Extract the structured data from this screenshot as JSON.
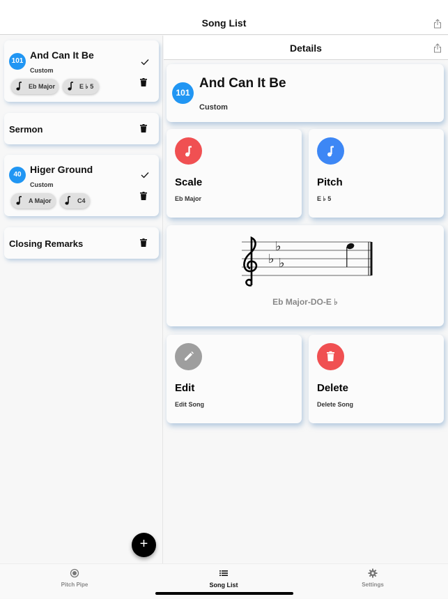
{
  "app": {
    "title": "Song List",
    "share_icon": "share-icon"
  },
  "song_list": {
    "items": [
      {
        "type": "song",
        "number": "101",
        "title": "And Can It Be",
        "subtitle": "Custom",
        "chips": [
          {
            "icon": "music-note-icon",
            "label": "Eb Major"
          },
          {
            "icon": "music-note-icon",
            "label": "E ♭ 5"
          }
        ],
        "selected": true
      },
      {
        "type": "section",
        "title": "Sermon"
      },
      {
        "type": "song",
        "number": "40",
        "title": "Higer Ground",
        "subtitle": "Custom",
        "chips": [
          {
            "icon": "music-note-icon",
            "label": "A Major"
          },
          {
            "icon": "music-note-icon",
            "label": "C4"
          }
        ],
        "selected": true
      },
      {
        "type": "section",
        "title": "Closing Remarks"
      }
    ],
    "add_button": "+"
  },
  "details": {
    "header_title": "Details",
    "song": {
      "number": "101",
      "title": "And Can It Be",
      "subtitle": "Custom"
    },
    "scale": {
      "title": "Scale",
      "value": "Eb Major",
      "color": "#f05052"
    },
    "pitch": {
      "title": "Pitch",
      "value": "E ♭ 5",
      "color": "#3d87f5"
    },
    "staff": {
      "clef": "treble",
      "key_signature": "Eb Major (3 flats)",
      "caption": "Eb Major-DO-E ♭"
    },
    "edit": {
      "title": "Edit",
      "subtitle": "Edit Song",
      "color": "#9e9e9e"
    },
    "delete": {
      "title": "Delete",
      "subtitle": "Delete Song",
      "color": "#f05052"
    }
  },
  "tabbar": {
    "tabs": [
      {
        "label": "Pitch Pipe",
        "icon": "radio-button-icon",
        "active": false
      },
      {
        "label": "Song List",
        "icon": "list-icon",
        "active": true
      },
      {
        "label": "Settings",
        "icon": "gear-icon",
        "active": false
      }
    ]
  },
  "colors": {
    "badge": "#2196f3",
    "accent_red": "#f05052",
    "accent_blue": "#3d87f5"
  }
}
